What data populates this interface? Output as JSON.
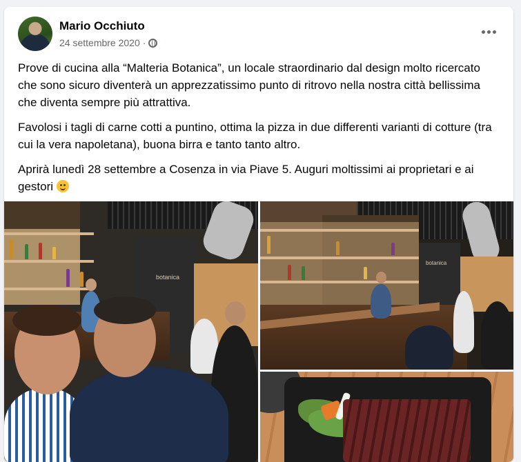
{
  "post": {
    "author": "Mario Occhiuto",
    "date": "24 settembre 2020",
    "separator": "·",
    "privacy_icon": "globe-icon",
    "more_icon": "more-horizontal-icon",
    "paragraphs": [
      "Prove di cucina alla “Malteria Botanica”, un locale straordinario dal design molto ricercato che sono sicuro diventerà un apprezzatissimo punto di ritrovo nella nostra città bellissima che diventa sempre più attrattiva.",
      "Favolosi i tagli di carne cotti a puntino, ottima la pizza in due differenti varianti di cotture (tra cui la vera napoletana), buona birra e tanto tanto altro.",
      "Aprirà lunedì 28 settembre a Cosenza in via Piave 5. Auguri moltissimi ai proprietari e ai gestori"
    ],
    "emoji": "smiling-face-emoji"
  },
  "photos": {
    "photo1_sign": "botanica",
    "photo2_sign": "botanica"
  }
}
